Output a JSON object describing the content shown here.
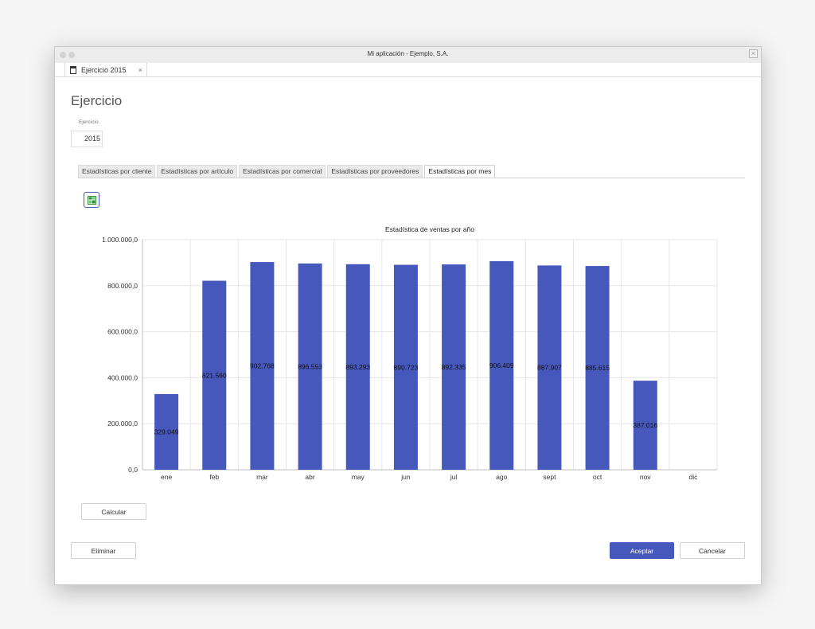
{
  "window": {
    "title": "Mi aplicación - Ejemplo, S.A."
  },
  "doc_tab": {
    "label": "Ejercicio 2015",
    "close": "×"
  },
  "page": {
    "title": "Ejercicio"
  },
  "ejercicio_field": {
    "label": "Ejercicio",
    "value": "2015"
  },
  "tabs": [
    {
      "label": "Estadísticas por cliente"
    },
    {
      "label": "Estadísticas por artículo"
    },
    {
      "label": "Estadísticas por comercial"
    },
    {
      "label": "Estadísticas por proveedores"
    },
    {
      "label": "Estadísticas por mes",
      "active": true
    }
  ],
  "buttons": {
    "calcular": "Calcular",
    "eliminar": "Eliminar",
    "aceptar": "Aceptar",
    "cancelar": "Cancelar"
  },
  "icons": {
    "export": "spreadsheet-export-icon",
    "doc_tab": "calculator-icon"
  },
  "colors": {
    "accent": "#4758bd",
    "bar": "#4758bd"
  },
  "chart_data": {
    "type": "bar",
    "title": "Estadística de ventas por año",
    "categories": [
      "ene",
      "feb",
      "mar",
      "abr",
      "may",
      "jun",
      "jul",
      "ago",
      "sept",
      "oct",
      "nov",
      "dic"
    ],
    "values": [
      329049,
      821560,
      902768,
      896553,
      893293,
      890723,
      892335,
      906409,
      887907,
      885615,
      387016,
      null
    ],
    "value_labels": [
      "329.049",
      "821.560",
      "902.768",
      "896.553",
      "893.293",
      "890.723",
      "892.335",
      "906.409",
      "887.907",
      "885.615",
      "387.016",
      ""
    ],
    "ylim": [
      0,
      1000000
    ],
    "yticks": [
      0,
      200000,
      400000,
      600000,
      800000,
      1000000
    ],
    "ytick_labels": [
      "0,0",
      "200.000,0",
      "400.000,0",
      "600.000,0",
      "800.000,0",
      "1.000.000,0"
    ],
    "grid": true,
    "legend": "none"
  }
}
